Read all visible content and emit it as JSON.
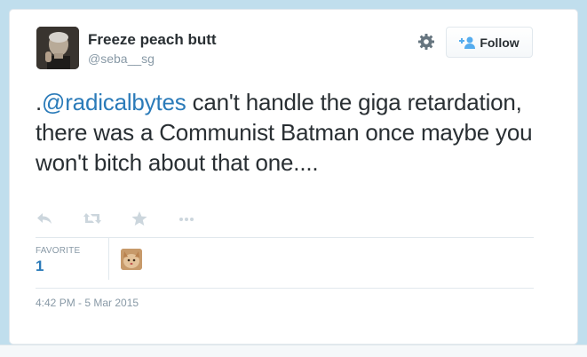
{
  "tweet": {
    "author_name": "Freeze peach butt",
    "author_handle": "@seba__sg",
    "text_prefix": ".",
    "mention": "@radicalbytes",
    "text_rest": " can't handle the giga retardation, there was a Communist Batman once maybe you won't bitch about that one....",
    "follow_label": "Follow",
    "favorite_label": "FAVORITE",
    "favorite_count": "1",
    "timestamp": "4:42 PM - 5 Mar 2015"
  },
  "actions": [
    {
      "name": "reply-icon"
    },
    {
      "name": "retweet-icon"
    },
    {
      "name": "favorite-star-icon"
    },
    {
      "name": "more-icon"
    }
  ],
  "colors": {
    "link": "#2b7bb9",
    "text": "#292f33",
    "muted": "#8899a6",
    "action_icon": "#ccd6dd",
    "background": "#c0deed"
  }
}
